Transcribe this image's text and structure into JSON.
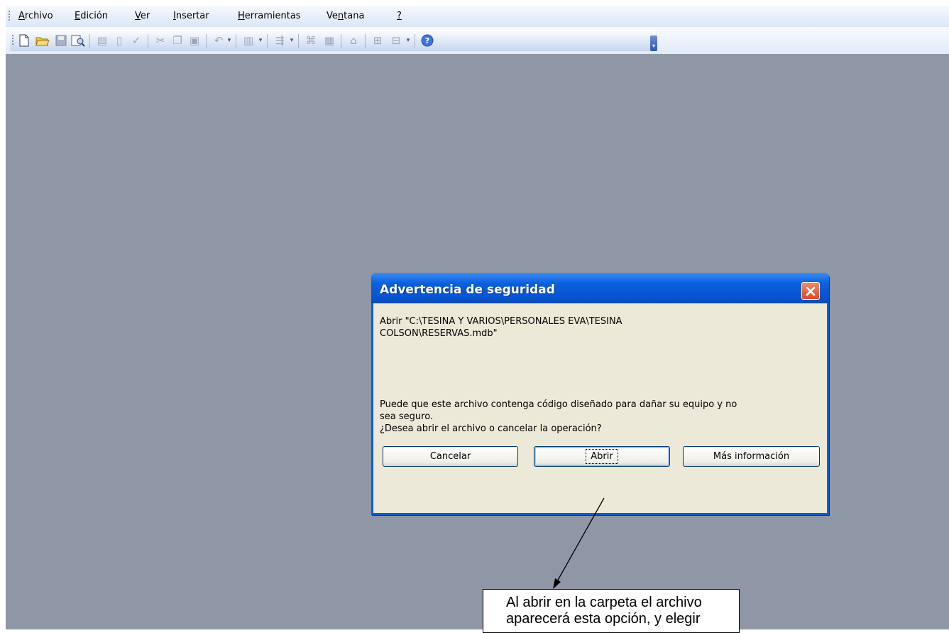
{
  "menubar": {
    "items": [
      {
        "label": "Archivo",
        "mnemonic": "A"
      },
      {
        "label": "Edición",
        "mnemonic": "E"
      },
      {
        "label": "Ver",
        "mnemonic": "V"
      },
      {
        "label": "Insertar",
        "mnemonic": "I"
      },
      {
        "label": "Herramientas",
        "mnemonic": "H"
      },
      {
        "label": "Ventana",
        "mnemonic": "n"
      },
      {
        "label": "?",
        "mnemonic": "?"
      }
    ]
  },
  "toolbar": {
    "icons": [
      "new-icon",
      "open-icon",
      "save-icon",
      "file-search-icon",
      "print-icon",
      "print-preview-icon",
      "spelling-icon",
      "cut-icon",
      "copy-icon",
      "paste-icon",
      "undo-icon",
      "analyze-icon",
      "office-links-icon",
      "code-icon",
      "properties-icon",
      "relationships-icon",
      "new-object-icon",
      "help-icon"
    ]
  },
  "dialog": {
    "title": "Advertencia de seguridad",
    "message_line1": "Abrir \"C:\\TESINA Y VARIOS\\PERSONALES EVA\\TESINA",
    "message_line2": "COLSON\\RESERVAS.mdb\"",
    "warning_line1": "Puede que este archivo contenga código diseñado para dañar su equipo y no",
    "warning_line2": "sea seguro.",
    "question": "¿Desea abrir el archivo o cancelar la operación?",
    "buttons": {
      "cancel": "Cancelar",
      "open": "Abrir",
      "more_info": "Más información"
    }
  },
  "annotation": {
    "line1": "Al abrir en la carpeta el archivo",
    "line2": "aparecerá esta opción, y elegir"
  },
  "colors": {
    "workspace": "#8f96a6",
    "title_bar": "#0a5fdd",
    "dialog_body": "#ece9d8",
    "close_button": "#dc4a25"
  }
}
